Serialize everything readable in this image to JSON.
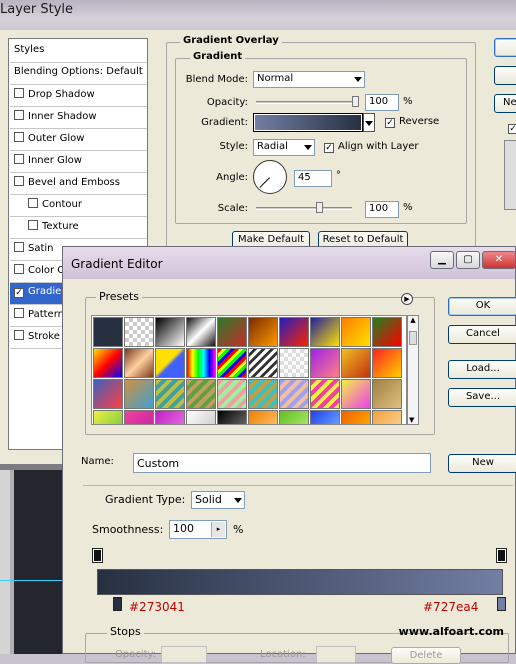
{
  "layer_style": {
    "title": "Layer Style",
    "styles_header": "Styles",
    "items": [
      {
        "label": "Blending Options: Default",
        "check": false
      },
      {
        "label": "Drop Shadow",
        "check": true,
        "checked": false
      },
      {
        "label": "Inner Shadow",
        "check": true,
        "checked": false
      },
      {
        "label": "Outer Glow",
        "check": true,
        "checked": false
      },
      {
        "label": "Inner Glow",
        "check": true,
        "checked": false
      },
      {
        "label": "Bevel and Emboss",
        "check": true,
        "checked": false
      },
      {
        "label": "Contour",
        "check": true,
        "checked": false,
        "indent": true
      },
      {
        "label": "Texture",
        "check": true,
        "checked": false,
        "indent": true
      },
      {
        "label": "Satin",
        "check": true,
        "checked": false
      },
      {
        "label": "Color Ov",
        "check": true,
        "checked": false
      },
      {
        "label": "Gradie",
        "check": true,
        "checked": true,
        "selected": true
      },
      {
        "label": "Pattern",
        "check": true,
        "checked": false
      },
      {
        "label": "Stroke",
        "check": true,
        "checked": false
      }
    ],
    "group_title": "Gradient Overlay",
    "subgroup_title": "Gradient",
    "blend_mode_label": "Blend Mode:",
    "blend_mode_value": "Normal",
    "opacity_label": "Opacity:",
    "opacity_value": "100",
    "opacity_unit": "%",
    "opacity_level": 1.0,
    "gradient_label": "Gradient:",
    "reverse_label": "Reverse",
    "reverse_checked": true,
    "style_label": "Style:",
    "style_value": "Radial",
    "align_label": "Align with Layer",
    "align_checked": true,
    "angle_label": "Angle:",
    "angle_value": "45",
    "angle_unit": "°",
    "scale_label": "Scale:",
    "scale_value": "100",
    "scale_unit": "%",
    "scale_level": 0.5,
    "make_default": "Make Default",
    "reset_default": "Reset to Default",
    "right_btn_partial": "Ne"
  },
  "gradient_editor": {
    "title": "Gradient Editor",
    "presets_label": "Presets",
    "ok": "OK",
    "cancel": "Cancel",
    "load": "Load...",
    "save": "Save...",
    "name_label": "Name:",
    "name_value": "Custom",
    "new_button": "New",
    "type_label": "Gradient Type:",
    "type_value": "Solid",
    "smoothness_label": "Smoothness:",
    "smoothness_value": "100",
    "smoothness_unit": "%",
    "left_color": "#273041",
    "right_color": "#727ea4",
    "stops_label": "Stops",
    "opacity_label": "Opacity:",
    "location_label": "Location:",
    "delete_label": "Delete"
  },
  "watermark": "www.alfoart.com",
  "colors": {
    "gradient_start": "#273041",
    "gradient_end": "#727ea4",
    "selection": "#3366cc"
  }
}
